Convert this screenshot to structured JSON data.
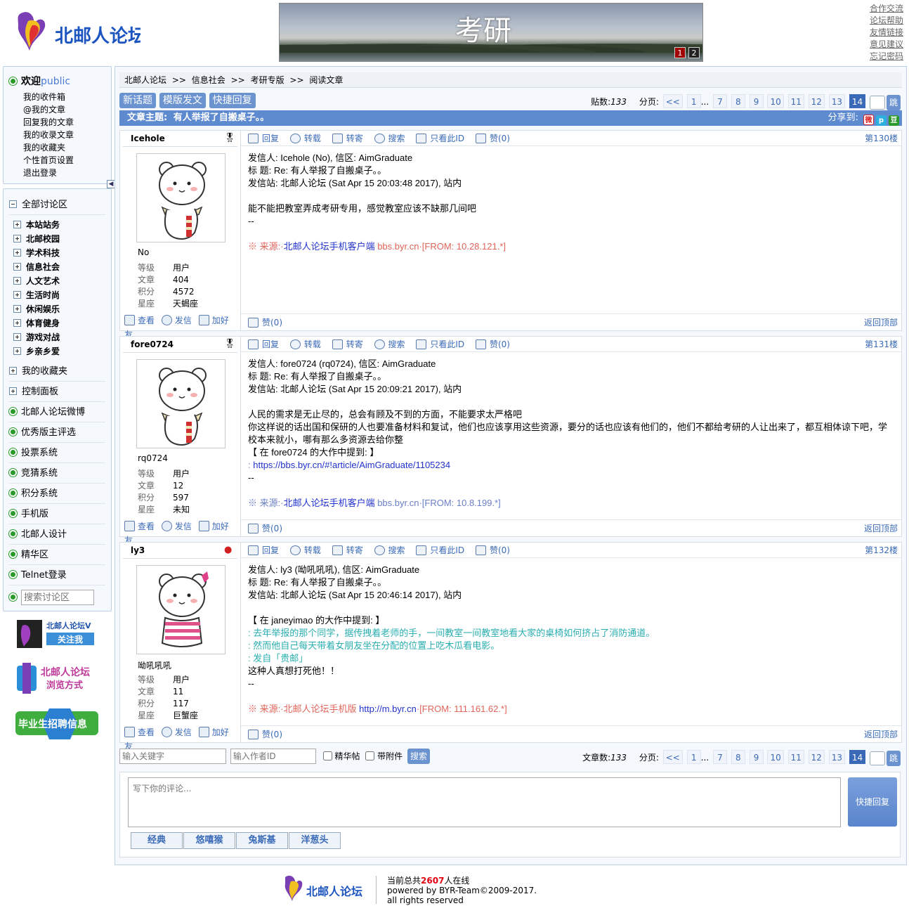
{
  "header": {
    "logo_text": "北邮人论坛",
    "banner_title": "考研",
    "banner_pages": [
      "1",
      "2"
    ],
    "links": [
      "合作交流",
      "论坛帮助",
      "友情链接",
      "意见建议",
      "忘记密码"
    ]
  },
  "user": {
    "welcome": "欢迎",
    "name": "public",
    "links": [
      "我的收件箱",
      "@我的文章",
      "回复我的文章",
      "我的收录文章",
      "我的收藏夹",
      "个性首页设置",
      "退出登录"
    ]
  },
  "nav": {
    "root": "全部讨论区",
    "boards": [
      "本站站务",
      "北邮校园",
      "学术科技",
      "信息社会",
      "人文艺术",
      "生活时尚",
      "休闲娱乐",
      "体育健身",
      "游戏对战",
      "乡亲乡爱"
    ],
    "items": [
      {
        "label": "我的收藏夹",
        "icon": "plus"
      },
      {
        "label": "控制面板",
        "icon": "plus"
      },
      {
        "label": "北邮人论坛微博",
        "icon": "dot"
      },
      {
        "label": "优秀版主评选",
        "icon": "dot"
      },
      {
        "label": "投票系统",
        "icon": "dot"
      },
      {
        "label": "竞猜系统",
        "icon": "dot"
      },
      {
        "label": "积分系统",
        "icon": "dot"
      },
      {
        "label": "手机版",
        "icon": "dot"
      },
      {
        "label": "北邮人设计",
        "icon": "dot"
      },
      {
        "label": "精华区",
        "icon": "dot"
      },
      {
        "label": "Telnet登录",
        "icon": "dot"
      }
    ],
    "search_placeholder": "搜索讨论区",
    "promos": [
      {
        "top": "北邮人论坛V",
        "bottom": "关注我"
      },
      {
        "top": "北邮人论坛",
        "bottom": "浏览方式"
      },
      {
        "top": "毕业生招聘信息",
        "bottom": ""
      }
    ]
  },
  "breadcrumb": [
    "北邮人论坛",
    ">>",
    "信息社会",
    ">>",
    "考研专版",
    ">>",
    "阅读文章"
  ],
  "buttons": {
    "new_topic": "新话题",
    "template_post": "模版发文",
    "quick_reply": "快捷回复"
  },
  "pager": {
    "top_label": "贴数:",
    "count": "133",
    "bottom_label": "文章数:",
    "page_label": "分页:",
    "first": "<<",
    "pages": [
      "1",
      "...",
      "7",
      "8",
      "9",
      "10",
      "11",
      "12",
      "13",
      "14"
    ],
    "current": "14",
    "go": "跳"
  },
  "topic": {
    "label": "文章主题:",
    "title": "有人举报了自搬桌子。。",
    "share_label": "分享到:"
  },
  "post_actions": {
    "reply": "回复",
    "forward": "转载",
    "repost": "转寄",
    "search": "搜索",
    "only_this": "只看此ID",
    "like": "赞(0)",
    "view": "查看",
    "message": "发信",
    "add_friend": "加好友",
    "back_top": "返回顶部"
  },
  "stats_labels": {
    "level": "等级",
    "articles": "文章",
    "score": "积分",
    "zodiac": "星座"
  },
  "posts": [
    {
      "author": "Icehole",
      "floor": "第130楼",
      "nick": "No",
      "level": "用户",
      "articles": "404",
      "score": "4572",
      "zodiac": "天蝎座",
      "lines": [
        "发信人: Icehole (No), 信区: AimGraduate",
        "标  题: Re: 有人举报了自搬桌子。。",
        "发信站: 北邮人论坛 (Sat Apr 15 20:03:48 2017), 站内",
        "",
        "能不能把教室弄成考研专用，感觉教室应该不缺那几间吧",
        "--",
        ""
      ],
      "source_prefix": "※ 来源:·",
      "source_link": "北邮人论坛手机客户端",
      "source_tail": " bbs.byr.cn·[FROM: 10.28.121.*]"
    },
    {
      "author": "fore0724",
      "floor": "第131楼",
      "nick": "rq0724",
      "level": "用户",
      "articles": "12",
      "score": "597",
      "zodiac": "未知",
      "lines": [
        "发信人: fore0724 (rq0724), 信区: AimGraduate",
        "标  题: Re: 有人举报了自搬桌子。。",
        "发信站: 北邮人论坛 (Sat Apr 15 20:09:21 2017), 站内",
        "",
        "人民的需求是无止尽的，总会有顾及不到的方面，不能要求太严格吧",
        "你这样说的话出国和保研的人也要准备材料和复试，他们也应该享用这些资源，要分的话也应该有他们的，他们不都给考研的人让出来了，都互相体谅下吧，学校本来就小，哪有那么多资源去给你整",
        "【 在 fore0724 的大作中提到: 】"
      ],
      "quote_link_prefix": ": ",
      "quote_link": "https://bbs.byr.cn/#!article/AimGraduate/1105234",
      "after": [
        "--",
        ""
      ],
      "source_prefix": "※ 来源:·",
      "source_link": "北邮人论坛手机客户端",
      "source_tail": " bbs.byr.cn·[FROM: 10.8.199.*]"
    },
    {
      "author": "ly3",
      "floor": "第132楼",
      "nick": "呦吼吼吼",
      "level": "用户",
      "articles": "11",
      "score": "117",
      "zodiac": "巨蟹座",
      "lines": [
        "发信人: ly3 (呦吼吼吼), 信区: AimGraduate",
        "标  题: Re: 有人举报了自搬桌子。。",
        "发信站: 北邮人论坛 (Sat Apr 15 20:46:14 2017), 站内",
        "",
        "【 在 janeyimao 的大作中提到: 】"
      ],
      "quotes": [
        ": 去年举报的那个同学，据传拽着老师的手，一间教室一间教室地看大家的桌椅如何挤占了消防通道。",
        ": 然而他自己每天带着女朋友坐在分配的位置上吃木瓜看电影。",
        ": 发自「贵邮」"
      ],
      "after": [
        "这种人真想打死他！！",
        "--",
        ""
      ],
      "source_prefix": "※ 来源:·北邮人论坛手机版 ",
      "source_link": "http://m.byr.cn",
      "source_tail": "·[FROM: 111.161.62.*]"
    }
  ],
  "search": {
    "keyword_placeholder": "输入关键字",
    "author_placeholder": "输入作者ID",
    "digest": "精华帖",
    "attachment": "带附件",
    "button": "搜索"
  },
  "reply": {
    "placeholder": "写下你的评论...",
    "button": "快捷回复",
    "emotions": [
      "经典",
      "悠嘻猴",
      "兔斯基",
      "洋葱头"
    ]
  },
  "footer": {
    "online_prefix": "当前总共",
    "online_count": "2607",
    "online_suffix": "人在线",
    "powered": "powered by BYR-Team©2009-2017.",
    "rights": "all rights reserved"
  },
  "colors": {
    "accent": "#5e8ad0",
    "panel_bg": "#f5f9fd",
    "link": "#3a6ab7",
    "red": "#e0000f"
  }
}
